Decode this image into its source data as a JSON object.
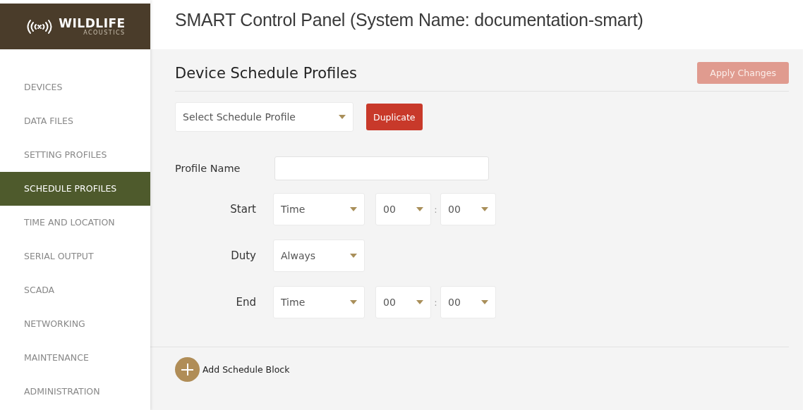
{
  "logo": {
    "name": "WILDLIFE",
    "tagline": "ACOUSTICS"
  },
  "title": "SMART Control Panel (System Name: documentation-smart)",
  "sidebar": {
    "items": [
      {
        "label": "DEVICES",
        "selected": false
      },
      {
        "label": "DATA FILES",
        "selected": false
      },
      {
        "label": "SETTING PROFILES",
        "selected": false
      },
      {
        "label": "SCHEDULE PROFILES",
        "selected": true
      },
      {
        "label": "TIME AND LOCATION",
        "selected": false
      },
      {
        "label": "SERIAL OUTPUT",
        "selected": false
      },
      {
        "label": "SCADA",
        "selected": false
      },
      {
        "label": "NETWORKING",
        "selected": false
      },
      {
        "label": "MAINTENANCE",
        "selected": false
      },
      {
        "label": "ADMINISTRATION",
        "selected": false
      }
    ]
  },
  "heading": "Device Schedule Profiles",
  "apply_button": {
    "label": "Apply Changes",
    "disabled": true
  },
  "profile_select": {
    "value": "Select Schedule Profile"
  },
  "duplicate_button": "Duplicate",
  "profile_name": {
    "label": "Profile Name"
  },
  "schedule_rows": [
    {
      "kind": "time",
      "label": "Start",
      "mode": "Time",
      "hour": "00",
      "separator": ":",
      "minute": "00"
    },
    {
      "kind": "choice",
      "label": "Duty",
      "mode": "Always"
    },
    {
      "kind": "time",
      "label": "End",
      "mode": "Time",
      "hour": "00",
      "separator": ":",
      "minute": "00"
    }
  ],
  "add_block": "Add Schedule Block"
}
